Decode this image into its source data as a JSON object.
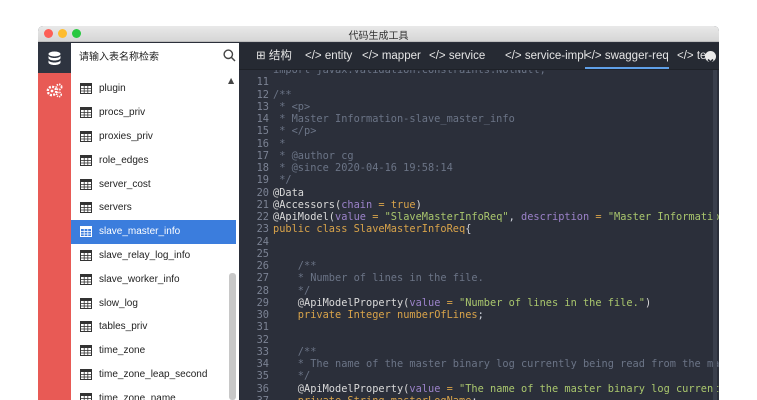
{
  "window": {
    "title": "代码生成工具"
  },
  "search": {
    "placeholder": "请输入表名称检索"
  },
  "tables": [
    {
      "name": "plugin",
      "selected": false
    },
    {
      "name": "procs_priv",
      "selected": false
    },
    {
      "name": "proxies_priv",
      "selected": false
    },
    {
      "name": "role_edges",
      "selected": false
    },
    {
      "name": "server_cost",
      "selected": false
    },
    {
      "name": "servers",
      "selected": false
    },
    {
      "name": "slave_master_info",
      "selected": true
    },
    {
      "name": "slave_relay_log_info",
      "selected": false
    },
    {
      "name": "slave_worker_info",
      "selected": false
    },
    {
      "name": "slow_log",
      "selected": false
    },
    {
      "name": "tables_priv",
      "selected": false
    },
    {
      "name": "time_zone",
      "selected": false
    },
    {
      "name": "time_zone_leap_second",
      "selected": false
    },
    {
      "name": "time_zone_name",
      "selected": false
    }
  ],
  "tabs": [
    {
      "label": "⊞ 结构",
      "active": false
    },
    {
      "label": "</> entity",
      "active": false
    },
    {
      "label": "</> mapper",
      "active": false
    },
    {
      "label": "</> service",
      "active": false
    },
    {
      "label": "</> service-impl",
      "active": false
    },
    {
      "label": "</> swagger-req",
      "active": true
    },
    {
      "label": "</> te",
      "active": false
    }
  ],
  "code": [
    {
      "n": "",
      "parts": [
        [
          "c-comment",
          "import javax.validation.constraints.NotNull;"
        ]
      ]
    },
    {
      "n": "11",
      "parts": []
    },
    {
      "n": "12",
      "parts": [
        [
          "c-comment",
          "/**"
        ]
      ]
    },
    {
      "n": "13",
      "parts": [
        [
          "c-comment",
          " * <p>"
        ]
      ]
    },
    {
      "n": "14",
      "parts": [
        [
          "c-comment",
          " * Master Information-slave_master_info"
        ]
      ]
    },
    {
      "n": "15",
      "parts": [
        [
          "c-comment",
          " * </p>"
        ]
      ]
    },
    {
      "n": "16",
      "parts": [
        [
          "c-comment",
          " *"
        ]
      ]
    },
    {
      "n": "17",
      "parts": [
        [
          "c-comment",
          " * @author cg"
        ]
      ]
    },
    {
      "n": "18",
      "parts": [
        [
          "c-comment",
          " * @since 2020-04-16 19:58:14"
        ]
      ]
    },
    {
      "n": "19",
      "parts": [
        [
          "c-comment",
          " */"
        ]
      ]
    },
    {
      "n": "20",
      "parts": [
        [
          "c-ann",
          "@Data"
        ]
      ]
    },
    {
      "n": "21",
      "parts": [
        [
          "c-ann",
          "@Accessors("
        ],
        [
          "c-param",
          "chain"
        ],
        [
          "c-op",
          " = "
        ],
        [
          "c-kw",
          "true"
        ],
        [
          "c-ann",
          ")"
        ]
      ]
    },
    {
      "n": "22",
      "parts": [
        [
          "c-ann",
          "@ApiModel("
        ],
        [
          "c-param",
          "value"
        ],
        [
          "c-op",
          " = "
        ],
        [
          "c-str",
          "\"SlaveMasterInfoReq\""
        ],
        [
          "c-plain",
          ", "
        ],
        [
          "c-param",
          "description"
        ],
        [
          "c-op",
          " = "
        ],
        [
          "c-str",
          "\"Master Information-slave_master_info\""
        ],
        [
          "c-ann",
          ")"
        ]
      ]
    },
    {
      "n": "23",
      "parts": [
        [
          "c-kw",
          "public class "
        ],
        [
          "c-kw",
          "SlaveMasterInfoReq"
        ],
        [
          "c-plain",
          "{"
        ]
      ]
    },
    {
      "n": "24",
      "parts": []
    },
    {
      "n": "25",
      "parts": []
    },
    {
      "n": "26",
      "parts": [
        [
          "c-comment",
          "    /**"
        ]
      ]
    },
    {
      "n": "27",
      "parts": [
        [
          "c-comment",
          "    * Number of lines in the file."
        ]
      ]
    },
    {
      "n": "28",
      "parts": [
        [
          "c-comment",
          "    */"
        ]
      ]
    },
    {
      "n": "29",
      "parts": [
        [
          "c-ann",
          "    @ApiModelProperty("
        ],
        [
          "c-param",
          "value"
        ],
        [
          "c-op",
          " = "
        ],
        [
          "c-str",
          "\"Number of lines in the file.\""
        ],
        [
          "c-ann",
          ")"
        ]
      ]
    },
    {
      "n": "30",
      "parts": [
        [
          "c-kw",
          "    private Integer "
        ],
        [
          "c-kw",
          "numberOfLines"
        ],
        [
          "c-plain",
          ";"
        ]
      ]
    },
    {
      "n": "31",
      "parts": []
    },
    {
      "n": "32",
      "parts": []
    },
    {
      "n": "33",
      "parts": [
        [
          "c-comment",
          "    /**"
        ]
      ]
    },
    {
      "n": "34",
      "parts": [
        [
          "c-comment",
          "    * The name of the master binary log currently being read from the master."
        ]
      ]
    },
    {
      "n": "35",
      "parts": [
        [
          "c-comment",
          "    */"
        ]
      ]
    },
    {
      "n": "36",
      "parts": [
        [
          "c-ann",
          "    @ApiModelProperty("
        ],
        [
          "c-param",
          "value"
        ],
        [
          "c-op",
          " = "
        ],
        [
          "c-str",
          "\"The name of the master binary log currently being read from the master.\""
        ],
        [
          "c-ann",
          ")"
        ]
      ]
    },
    {
      "n": "37",
      "parts": [
        [
          "c-kw",
          "    private String "
        ],
        [
          "c-kw",
          "masterLogName"
        ],
        [
          "c-plain",
          ";"
        ]
      ]
    }
  ],
  "icons": {
    "database": "database-icon",
    "settings": "gear-icon",
    "search": "search-icon",
    "table": "table-icon",
    "more": "chevron-down-icon"
  },
  "colors": {
    "rail": "#e85a55",
    "selected": "#3b7ddd",
    "editor_bg": "#2b2f3a",
    "tab_active": "#5fa0e8"
  }
}
